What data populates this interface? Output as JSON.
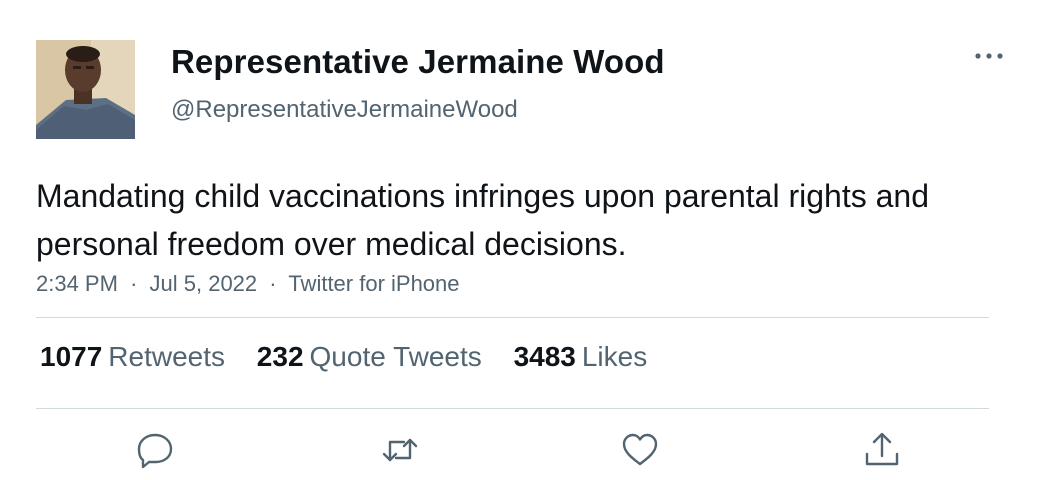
{
  "tweet": {
    "display_name": "Representative Jermaine Wood",
    "handle": "@RepresentativeJermaineWood",
    "text": "Mandating child vaccinations infringes upon parental rights and personal freedom over medical decisions.",
    "time": "2:34 PM",
    "date": "Jul 5, 2022",
    "source": "Twitter for iPhone",
    "separator": "·"
  },
  "stats": {
    "retweets_count": "1077",
    "retweets_label": "Retweets",
    "quotes_count": "232",
    "quotes_label": "Quote Tweets",
    "likes_count": "3483",
    "likes_label": "Likes"
  },
  "icons": {
    "more": "more-horizontal-icon",
    "reply": "reply-icon",
    "retweet": "retweet-icon",
    "like": "heart-icon",
    "share": "share-icon"
  },
  "colors": {
    "text_primary": "#0f1419",
    "text_secondary": "#536471",
    "divider": "#cfd9de",
    "icon": "#536471"
  }
}
